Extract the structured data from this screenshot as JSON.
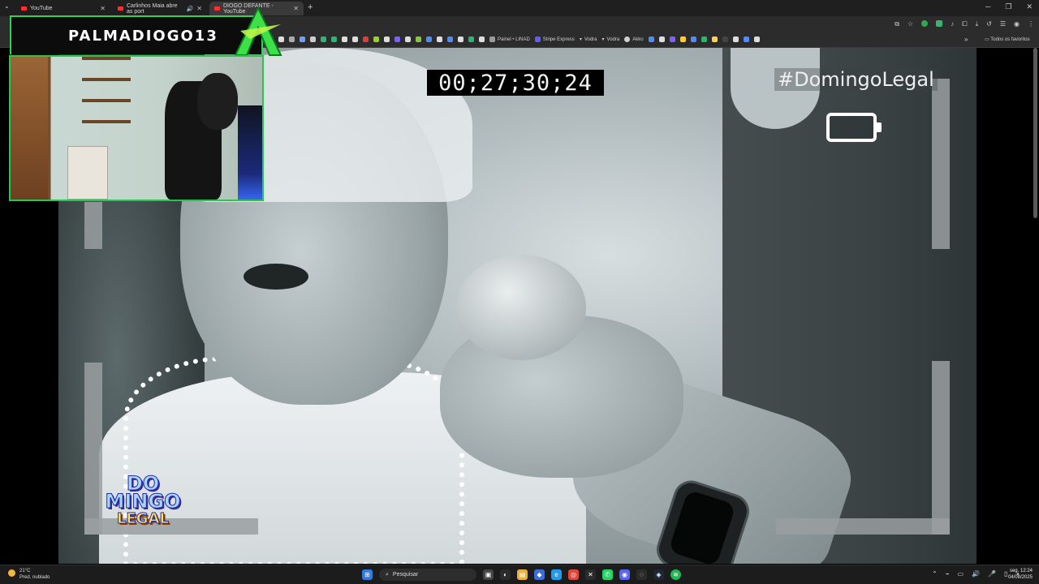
{
  "browser": {
    "tabs": [
      {
        "label": "YouTube",
        "active": false
      },
      {
        "label": "Carlinhos Maia abre as port",
        "active": false
      },
      {
        "label": "DIOGO DEFANTE - YouTube",
        "active": true
      }
    ],
    "bookmarks": [
      {
        "label": "Painel • LINAD",
        "color": "#9b9b9b"
      },
      {
        "label": "Stripe Express",
        "color": "#635bff"
      },
      {
        "label": "Vodra",
        "color": "#cfcfcf"
      },
      {
        "label": "Vodra",
        "color": "#cfcfcf"
      },
      {
        "label": "Akko",
        "color": "#cfcfcf"
      }
    ],
    "all_bookmarks_label": "Todos os favoritos"
  },
  "overlay": {
    "channel_name": "PALMADIOGO13",
    "accent_color": "#22c94a"
  },
  "video": {
    "timecode": "00;27;30;24",
    "hashtag": "#DomingoLegal",
    "show_logo": {
      "line1": "DO",
      "line2": "MINGO",
      "line3": "LEGAL"
    }
  },
  "taskbar": {
    "weather_temp": "21°C",
    "weather_desc": "Pred. nublado",
    "search_placeholder": "Pesquisar",
    "time": "12:24",
    "date": "04/08/2025",
    "day": "seg."
  }
}
